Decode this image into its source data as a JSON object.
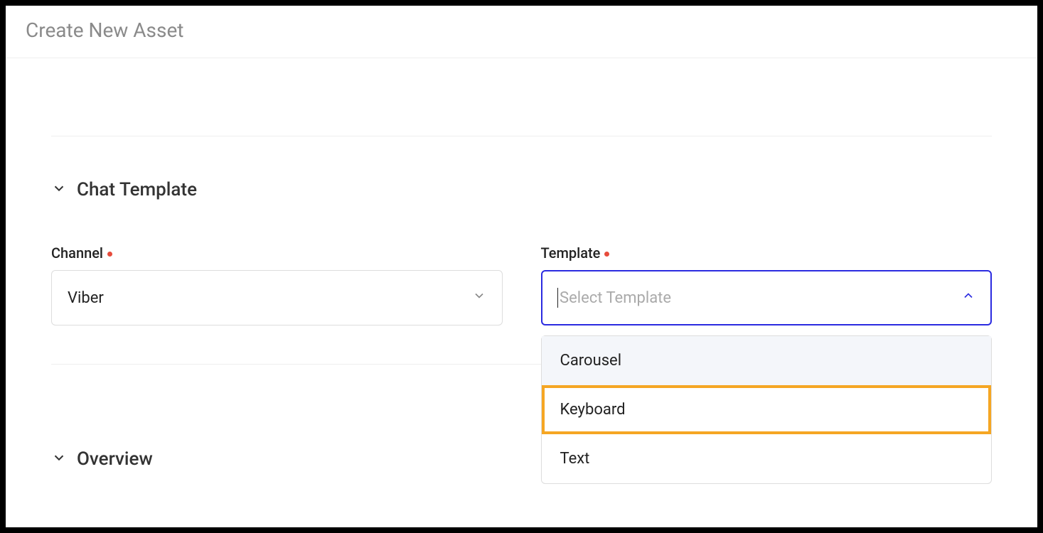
{
  "header": {
    "title": "Create New Asset"
  },
  "sections": {
    "chat_template": {
      "title": "Chat Template",
      "channel": {
        "label": "Channel",
        "value": "Viber"
      },
      "template": {
        "label": "Template",
        "placeholder": "Select Template",
        "options": [
          {
            "label": "Carousel",
            "state": "hover"
          },
          {
            "label": "Keyboard",
            "state": "highlighted"
          },
          {
            "label": "Text",
            "state": "normal"
          }
        ]
      }
    },
    "overview": {
      "title": "Overview"
    }
  }
}
